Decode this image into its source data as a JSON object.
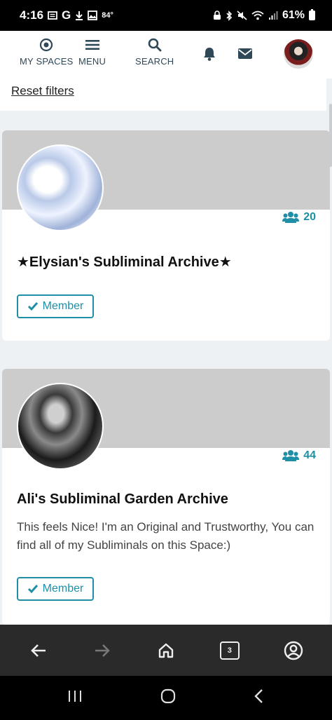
{
  "status_bar": {
    "time": "4:16",
    "notif_icons": [
      "news-icon",
      "google-icon",
      "download-icon",
      "gallery-icon"
    ],
    "temperature": "84°",
    "battery": "61%"
  },
  "top_nav": {
    "my_spaces_label": "MY SPACES",
    "menu_label": "MENU",
    "search_label": "SEARCH"
  },
  "filters": {
    "reset_label": "Reset filters"
  },
  "spaces": [
    {
      "title": "★Elysian's Subliminal Archive★",
      "member_count": "20",
      "description": "",
      "membership_label": "Member"
    },
    {
      "title": "Ali's Subliminal Garden Archive",
      "member_count": "44",
      "description": "This feels Nice! I'm an Original and Trustworthy, You can find all of my Subliminals on this Space:)",
      "membership_label": "Member"
    }
  ],
  "browser_bar": {
    "tab_count": "3"
  },
  "colors": {
    "accent": "#1e8fa6",
    "nav_text": "#2f4858",
    "cover_gray": "#cccccc"
  }
}
